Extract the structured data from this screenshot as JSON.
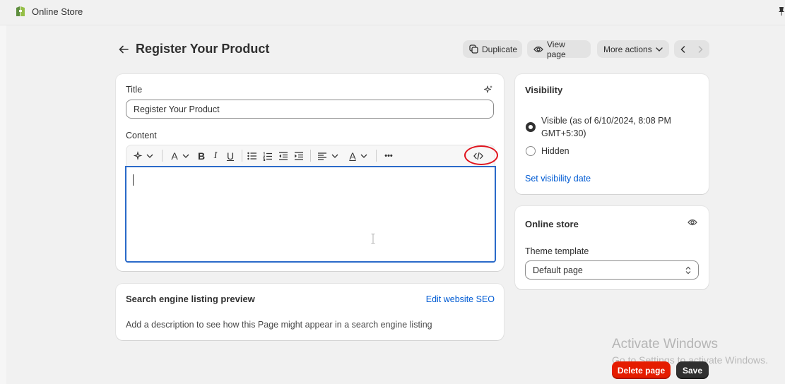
{
  "app": {
    "name": "Online Store",
    "logo_icon": "shopify-bag-icon",
    "brand_color": "#5e8e3e"
  },
  "header": {
    "title": "Register Your Product",
    "duplicate_label": "Duplicate",
    "view_page_label": "View page",
    "more_actions_label": "More actions"
  },
  "main": {
    "title_label": "Title",
    "title_value": "Register Your Product",
    "content_label": "Content",
    "toolbar": {
      "items": [
        "ai-sparkle-icon",
        "font-icon",
        "bold-icon",
        "italic-icon",
        "underline-icon",
        "bullet-list-icon",
        "numbered-list-icon",
        "outdent-icon",
        "indent-icon",
        "align-icon",
        "text-color-icon",
        "more-icon",
        "code-view-icon"
      ],
      "font_glyph": "A",
      "bold_glyph": "B",
      "italic_glyph": "I",
      "underline_glyph": "U",
      "color_glyph": "A",
      "more_glyph": "•••"
    },
    "highlight_color": "#e0141e"
  },
  "seo": {
    "title": "Search engine listing preview",
    "edit_link": "Edit website SEO",
    "description": "Add a description to see how this Page might appear in a search engine listing"
  },
  "visibility": {
    "heading": "Visibility",
    "visible_label": "Visible (as of 6/10/2024, 8:08 PM GMT+5:30)",
    "hidden_label": "Hidden",
    "selected": "visible",
    "set_date_link": "Set visibility date"
  },
  "online_store": {
    "heading": "Online store",
    "theme_label": "Theme template",
    "theme_value": "Default page"
  },
  "footer": {
    "delete_label": "Delete page",
    "save_label": "Save"
  },
  "watermark": {
    "title": "Activate Windows",
    "subtitle": "Go to Settings to activate Windows."
  }
}
